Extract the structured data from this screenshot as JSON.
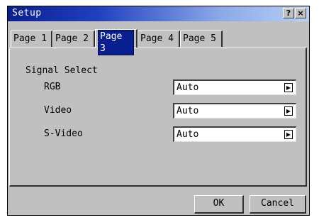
{
  "window": {
    "title": "Setup",
    "help_glyph": "?",
    "close_glyph": "×"
  },
  "tabs": [
    {
      "label": "Page 1",
      "active": false
    },
    {
      "label": "Page 2",
      "active": false
    },
    {
      "label": "Page 3",
      "active": true
    },
    {
      "label": "Page 4",
      "active": false
    },
    {
      "label": "Page 5",
      "active": false
    }
  ],
  "signal_select": {
    "label": "Signal Select",
    "rows": [
      {
        "label": "RGB",
        "value": "Auto"
      },
      {
        "label": "Video",
        "value": "Auto"
      },
      {
        "label": "S-Video",
        "value": "Auto"
      }
    ],
    "arrow_glyph": "▶"
  },
  "buttons": {
    "ok": "OK",
    "cancel": "Cancel"
  },
  "colors": {
    "title_bar": "#0a1f8f",
    "dialog_bg": "#c0c0c0",
    "active_tab": "#0a1f8f"
  }
}
